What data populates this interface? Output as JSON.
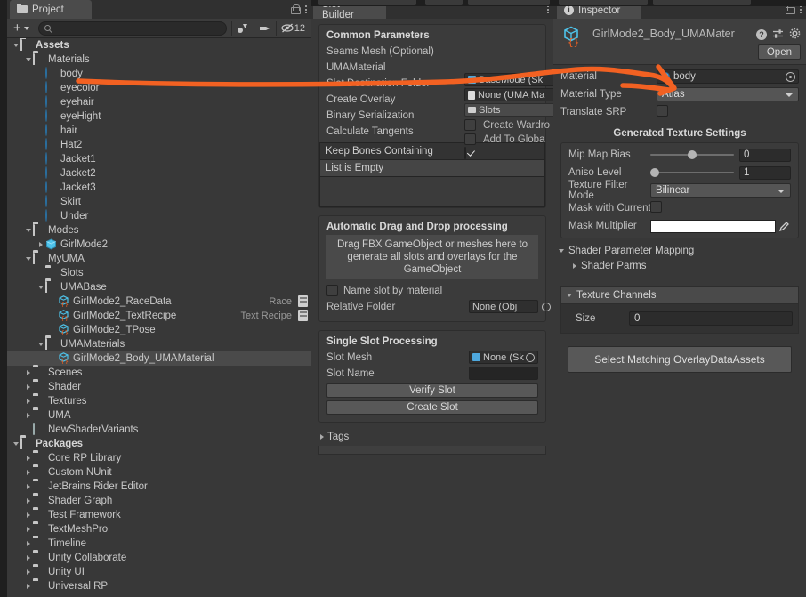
{
  "project": {
    "tab_label": "Project",
    "add_label": "+",
    "search_placeholder": "",
    "hidden_count": "12",
    "icons": {
      "lock": "lock-icon",
      "menu": "kebab-icon",
      "save_filter": "save-filter-icon",
      "label": "label-icon",
      "hidden": "hidden-eye-icon"
    },
    "tree": [
      {
        "depth": 0,
        "label": "Assets",
        "icon": "folder-open",
        "expanded": true,
        "bold": true,
        "selected": false
      },
      {
        "depth": 1,
        "label": "Materials",
        "icon": "folder-open",
        "expanded": true,
        "bold": false,
        "selected": false
      },
      {
        "depth": 2,
        "label": "body",
        "icon": "material",
        "expanded": null,
        "bold": false,
        "selected": false
      },
      {
        "depth": 2,
        "label": "eyecolor",
        "icon": "material",
        "expanded": null,
        "bold": false,
        "selected": false
      },
      {
        "depth": 2,
        "label": "eyehair",
        "icon": "material",
        "expanded": null,
        "bold": false,
        "selected": false
      },
      {
        "depth": 2,
        "label": "eyeHight",
        "icon": "material",
        "expanded": null,
        "bold": false,
        "selected": false
      },
      {
        "depth": 2,
        "label": "hair",
        "icon": "material",
        "expanded": null,
        "bold": false,
        "selected": false
      },
      {
        "depth": 2,
        "label": "Hat2",
        "icon": "material",
        "expanded": null,
        "bold": false,
        "selected": false
      },
      {
        "depth": 2,
        "label": "Jacket1",
        "icon": "material",
        "expanded": null,
        "bold": false,
        "selected": false
      },
      {
        "depth": 2,
        "label": "Jacket2",
        "icon": "material",
        "expanded": null,
        "bold": false,
        "selected": false
      },
      {
        "depth": 2,
        "label": "Jacket3",
        "icon": "material",
        "expanded": null,
        "bold": false,
        "selected": false
      },
      {
        "depth": 2,
        "label": "Skirt",
        "icon": "material",
        "expanded": null,
        "bold": false,
        "selected": false
      },
      {
        "depth": 2,
        "label": "Under",
        "icon": "material",
        "expanded": null,
        "bold": false,
        "selected": false
      },
      {
        "depth": 1,
        "label": "Modes",
        "icon": "folder-open",
        "expanded": true,
        "bold": false,
        "selected": false
      },
      {
        "depth": 2,
        "label": "GirlMode2",
        "icon": "prefab",
        "expanded": false,
        "bold": false,
        "selected": false
      },
      {
        "depth": 1,
        "label": "MyUMA",
        "icon": "folder-open",
        "expanded": true,
        "bold": false,
        "selected": false
      },
      {
        "depth": 2,
        "label": "Slots",
        "icon": "folder",
        "expanded": null,
        "bold": false,
        "selected": false
      },
      {
        "depth": 2,
        "label": "UMABase",
        "icon": "folder-open",
        "expanded": true,
        "bold": false,
        "selected": false
      },
      {
        "depth": 3,
        "label": "GirlMode2_RaceData",
        "icon": "uma",
        "expanded": null,
        "bold": false,
        "selected": false,
        "aux": "Race"
      },
      {
        "depth": 3,
        "label": "GirlMode2_TextRecipe",
        "icon": "uma",
        "expanded": null,
        "bold": false,
        "selected": false,
        "aux": "Text Recipe"
      },
      {
        "depth": 3,
        "label": "GirlMode2_TPose",
        "icon": "uma",
        "expanded": null,
        "bold": false,
        "selected": false
      },
      {
        "depth": 2,
        "label": "UMAMaterials",
        "icon": "folder-open",
        "expanded": true,
        "bold": false,
        "selected": false
      },
      {
        "depth": 3,
        "label": "GirlMode2_Body_UMAMaterial",
        "icon": "uma",
        "expanded": null,
        "bold": false,
        "selected": true
      },
      {
        "depth": 1,
        "label": "Scenes",
        "icon": "folder",
        "expanded": false,
        "bold": false,
        "selected": false
      },
      {
        "depth": 1,
        "label": "Shader",
        "icon": "folder",
        "expanded": false,
        "bold": false,
        "selected": false
      },
      {
        "depth": 1,
        "label": "Textures",
        "icon": "folder",
        "expanded": false,
        "bold": false,
        "selected": false
      },
      {
        "depth": 1,
        "label": "UMA",
        "icon": "folder",
        "expanded": false,
        "bold": false,
        "selected": false
      },
      {
        "depth": 1,
        "label": "NewShaderVariants",
        "icon": "shader",
        "expanded": null,
        "bold": false,
        "selected": false
      },
      {
        "depth": 0,
        "label": "Packages",
        "icon": "folder-open",
        "expanded": true,
        "bold": true,
        "selected": false
      },
      {
        "depth": 1,
        "label": "Core RP Library",
        "icon": "folder",
        "expanded": false,
        "bold": false,
        "selected": false
      },
      {
        "depth": 1,
        "label": "Custom NUnit",
        "icon": "folder",
        "expanded": false,
        "bold": false,
        "selected": false
      },
      {
        "depth": 1,
        "label": "JetBrains Rider Editor",
        "icon": "folder",
        "expanded": false,
        "bold": false,
        "selected": false
      },
      {
        "depth": 1,
        "label": "Shader Graph",
        "icon": "folder",
        "expanded": false,
        "bold": false,
        "selected": false
      },
      {
        "depth": 1,
        "label": "Test Framework",
        "icon": "folder",
        "expanded": false,
        "bold": false,
        "selected": false
      },
      {
        "depth": 1,
        "label": "TextMeshPro",
        "icon": "folder",
        "expanded": false,
        "bold": false,
        "selected": false
      },
      {
        "depth": 1,
        "label": "Timeline",
        "icon": "folder",
        "expanded": false,
        "bold": false,
        "selected": false
      },
      {
        "depth": 1,
        "label": "Unity Collaborate",
        "icon": "folder",
        "expanded": false,
        "bold": false,
        "selected": false
      },
      {
        "depth": 1,
        "label": "Unity UI",
        "icon": "folder",
        "expanded": false,
        "bold": false,
        "selected": false
      },
      {
        "depth": 1,
        "label": "Universal RP",
        "icon": "folder",
        "expanded": false,
        "bold": false,
        "selected": false
      }
    ]
  },
  "slot_builder": {
    "tab_label": "Slot Builder",
    "common": {
      "title": "Common Parameters",
      "seams_mesh_label": "Seams Mesh (Optional)",
      "seams_mesh_value": "BaseMode (Sk",
      "uma_material_label": "UMAMaterial",
      "uma_material_value": "None (UMA Ma",
      "slot_dest_label": "Slot Destination Folder",
      "slot_dest_value": "Slots",
      "create_overlay_label": "Create Overlay",
      "create_wardrobe_label": "Create Wardro",
      "create_overlay_checked": false,
      "binary_serialization_label": "Binary Serialization",
      "add_to_global_label": "Add To Globa",
      "binary_serialization_checked": false,
      "calculate_tangents_label": "Calculate Tangents",
      "calculate_tangents_checked": true,
      "keep_bones_label": "Keep Bones Containing",
      "keep_bones_empty": "List is Empty"
    },
    "dragdrop": {
      "title": "Automatic Drag and Drop processing",
      "dropzone_text": "Drag FBX GameObject or meshes here to generate all slots and overlays for the GameObject",
      "name_slot_label": "Name slot by material",
      "name_slot_checked": false,
      "relative_folder_label": "Relative Folder",
      "relative_folder_value": "None (Obj"
    },
    "single": {
      "title": "Single Slot Processing",
      "slot_mesh_label": "Slot Mesh",
      "slot_mesh_value": "None (Sk",
      "slot_name_label": "Slot Name",
      "slot_name_value": "",
      "verify_button": "Verify Slot",
      "create_button": "Create Slot"
    },
    "tags_label": "Tags"
  },
  "inspector": {
    "tab_label": "Inspector",
    "asset_title": "GirlMode2_Body_UMAMater",
    "open_button": "Open",
    "material_label": "Material",
    "material_value": "body",
    "material_type_label": "Material Type",
    "material_type_value": "Atlas",
    "translate_srp_label": "Translate SRP",
    "translate_srp_checked": false,
    "texture_settings_title": "Generated Texture Settings",
    "mip_map_bias_label": "Mip Map Bias",
    "mip_map_bias_value": "0",
    "aniso_level_label": "Aniso Level",
    "aniso_level_value": "1",
    "texture_filter_label": "Texture Filter Mode",
    "texture_filter_value": "Bilinear",
    "mask_current_label": "Mask with Current Co",
    "mask_current_checked": false,
    "mask_multiplier_label": "Mask Multiplier",
    "mask_multiplier_color": "#ffffff",
    "shader_param_mapping_label": "Shader Parameter Mapping",
    "shader_parms_label": "Shader Parms",
    "texture_channels_label": "Texture Channels",
    "size_label": "Size",
    "size_value": "0",
    "select_button": "Select Matching OverlayDataAssets"
  },
  "annotation": {
    "color": "#f26122",
    "shape": "arrow-from-body-material-to-inspector-material"
  }
}
